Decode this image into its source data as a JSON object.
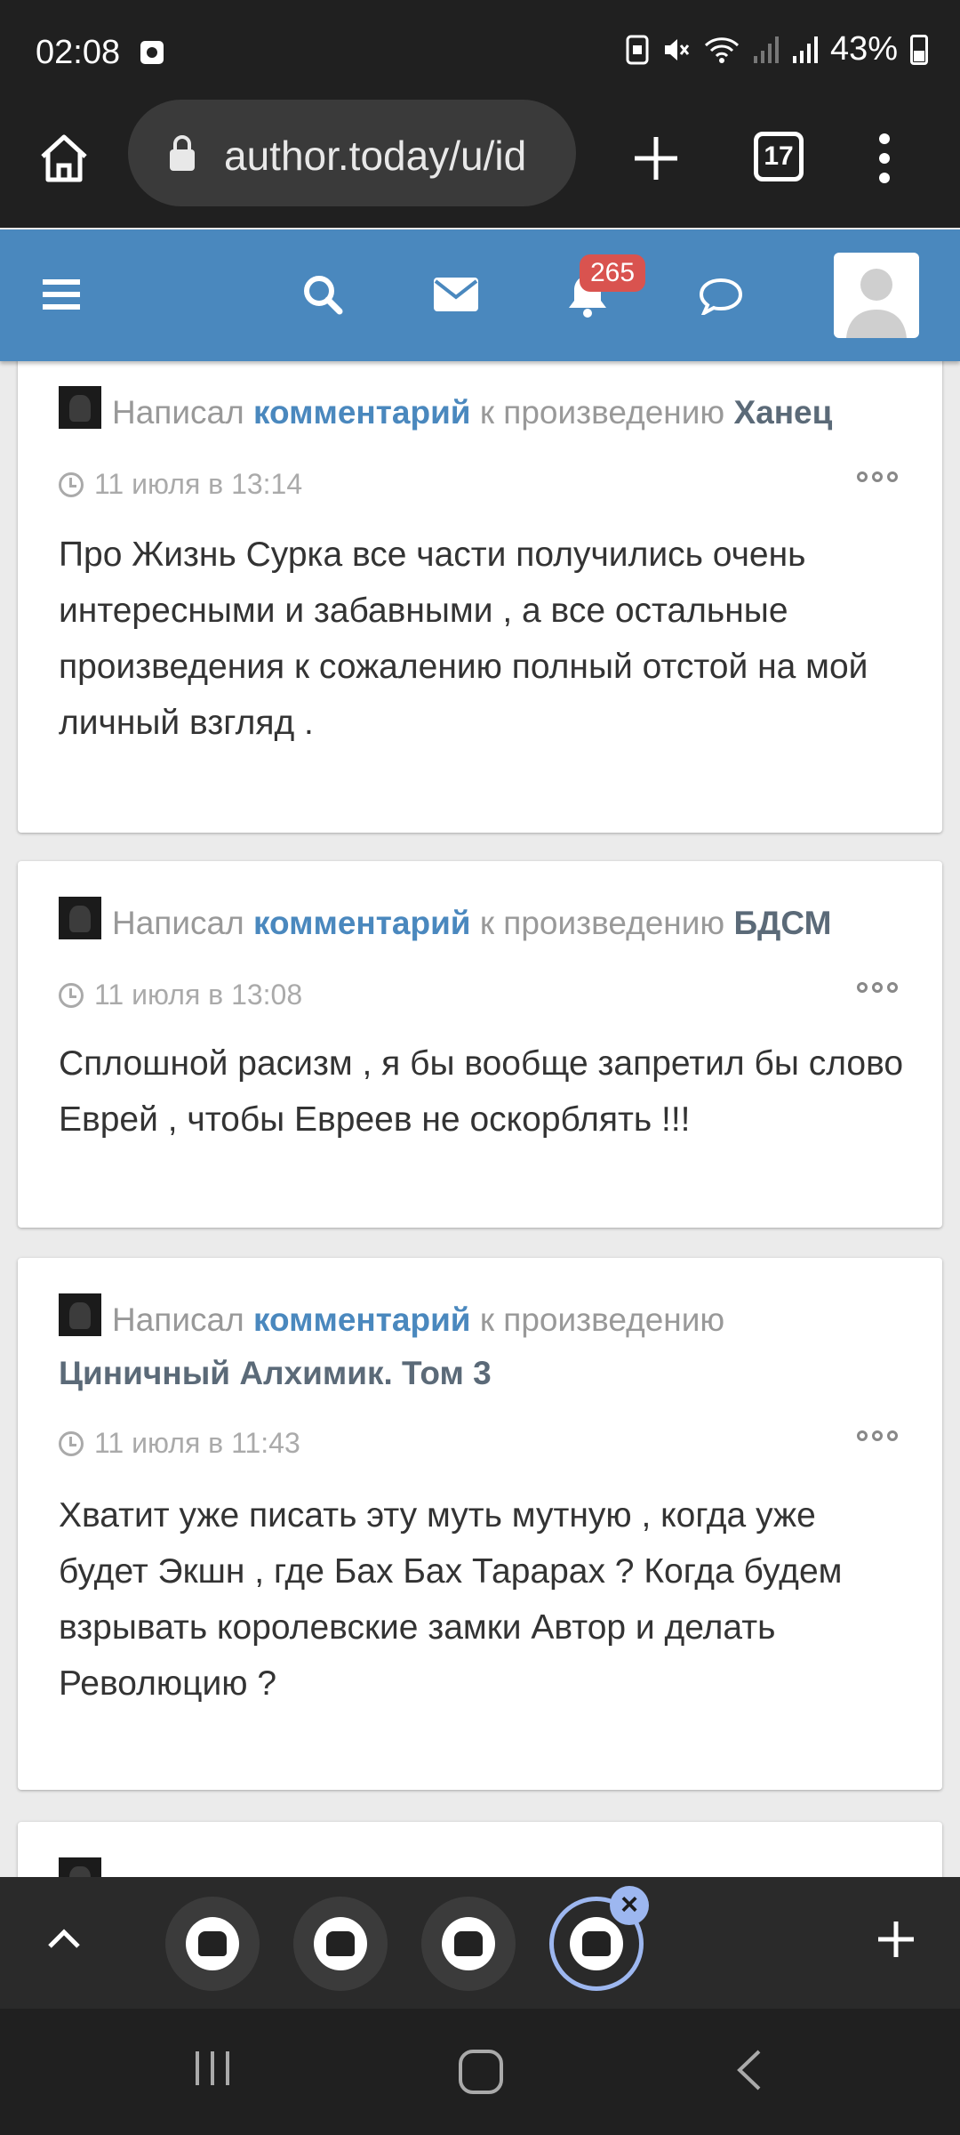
{
  "status_bar": {
    "time": "02:08",
    "battery": "43%"
  },
  "browser": {
    "url": "author.today/u/id",
    "tab_count": "17"
  },
  "header": {
    "notification_count": "265"
  },
  "feed": {
    "items": [
      {
        "prefix": "Написал",
        "action": "комментарий",
        "middle": "к произведению",
        "work": "Ханец",
        "date": "11 июля в 13:14",
        "text": "Про Жизнь Сурка все части получились очень интересными и забавными , а все остальные произведения к сожалению  полный отстой на мой личный взгляд ."
      },
      {
        "prefix": "Написал",
        "action": "комментарий",
        "middle": "к произведению",
        "work": "БДСМ",
        "date": "11 июля в 13:08",
        "text": "Сплошной расизм , я бы вообще запретил бы слово Еврей , чтобы Евреев не оскорблять !!!"
      },
      {
        "prefix": "Написал",
        "action": "комментарий",
        "middle": "к произведению",
        "work": "Циничный Алхимик. Том 3",
        "date": "11 июля в 11:43",
        "text": "Хватит уже писать эту муть мутную , когда уже будет Экшн , где Бах Бах Тарарах ? Когда будем взрывать королевские замки Автор и делать Революцию ?"
      }
    ]
  },
  "colors": {
    "header_bg": "#4a88be",
    "link_blue": "#4a88be",
    "badge_red": "#d9534f"
  }
}
